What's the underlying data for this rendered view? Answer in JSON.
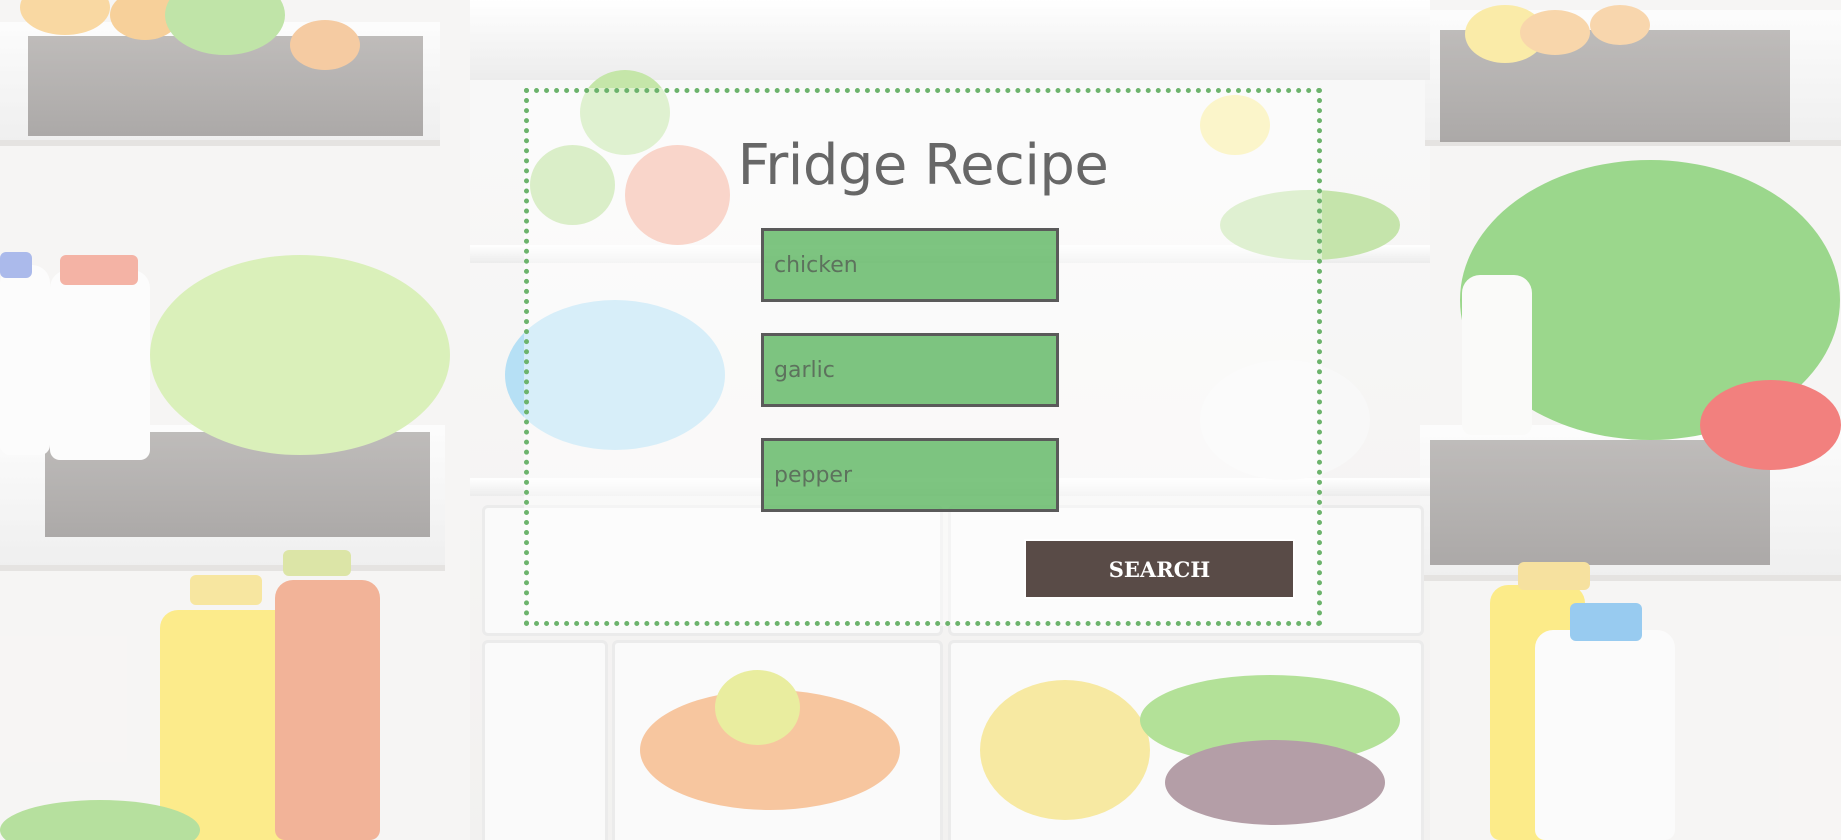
{
  "app": {
    "title": "Fridge Recipe"
  },
  "form": {
    "ingredients": [
      {
        "placeholder": "chicken",
        "value": ""
      },
      {
        "placeholder": "garlic",
        "value": ""
      },
      {
        "placeholder": "pepper",
        "value": ""
      }
    ],
    "search_label": "SEARCH"
  },
  "colors": {
    "panel_border": "#6cb36c",
    "field_fill": "#4caf50",
    "button_fill": "#594b47",
    "title_text": "#676767"
  }
}
